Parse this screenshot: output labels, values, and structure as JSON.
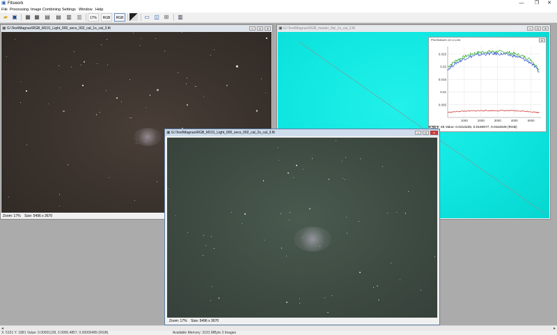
{
  "app": {
    "title": "Fitswork",
    "icon": "app-icon",
    "window_controls": [
      "—",
      "❐",
      "✕"
    ]
  },
  "menu": {
    "items": [
      "File",
      "Processing",
      "Image Combining",
      "Settings",
      "Window",
      "Help"
    ]
  },
  "toolbar": {
    "zoom_label": "17%",
    "rgb_label": "RGB",
    "rgb_label_2": "RGB"
  },
  "windows": {
    "light_dark": {
      "title": "G:\\Test\\Magnus\\RGB_M101_Light_900_secs_002_cal_1s_cal_3.fit",
      "zoom": "Zoom: 17%",
      "size": "Size: 5496 x 3670"
    },
    "flat": {
      "title": "G:\\Test\\Magnus\\RGB_master_flat_1s_cal_3.fit"
    },
    "light_green": {
      "title": "G:\\Test\\Magnus\\RGB_M101_Light_900_secs_002_cal_2s_cal_3.fit",
      "zoom": "Zoom: 17%",
      "size": "Size: 5496 x 3670"
    }
  },
  "chart_data": {
    "type": "line",
    "title": "Pixelvalues on a Line",
    "x_ticks": [
      1000,
      2000,
      3000,
      4000,
      5000
    ],
    "y_ticks": [
      0.005,
      0.01,
      0.015,
      0.02,
      0.025
    ],
    "xlim": [
      0,
      5600
    ],
    "ylim": [
      0,
      0.028
    ],
    "copy_label": "copy",
    "x": [
      0,
      500,
      1000,
      1500,
      2000,
      2500,
      3000,
      3500,
      4000,
      4500,
      5000,
      5500
    ],
    "series": [
      {
        "color": "#22aa22",
        "values": [
          0.02,
          0.0225,
          0.024,
          0.0252,
          0.0258,
          0.026,
          0.026,
          0.0258,
          0.0252,
          0.0242,
          0.0228,
          0.019
        ]
      },
      {
        "color": "#2244cc",
        "values": [
          0.019,
          0.0215,
          0.0232,
          0.0243,
          0.0249,
          0.0252,
          0.0252,
          0.0249,
          0.0243,
          0.0232,
          0.0216,
          0.0178
        ]
      },
      {
        "color": "#cc2222",
        "values": [
          0.002,
          0.0023,
          0.0025,
          0.0026,
          0.0027,
          0.0027,
          0.0027,
          0.0027,
          0.0026,
          0.0025,
          0.0023,
          0.0019
        ]
      }
    ],
    "readout": "X: 81  Y: 65  Value: 0.0213228, 0.0160977, 0.0154028 (RGB)"
  },
  "statusbar": {
    "left": "X: 5101  Y: 1881  Value: 0.00001128, 0.0000,4857, 0.00000489 (RGB)",
    "memory": "Available Memory: 3191 MByte  3 Images"
  }
}
